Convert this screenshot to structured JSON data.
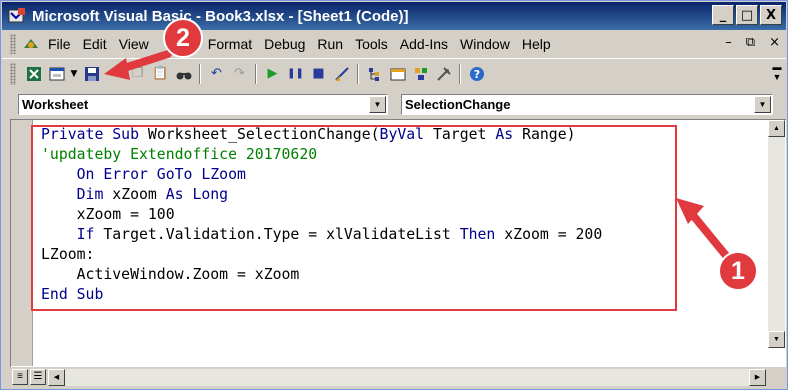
{
  "window": {
    "title": "Microsoft Visual Basic - Book3.xlsx - [Sheet1 (Code)]",
    "controls": {
      "minimize": "_",
      "restore": "□",
      "close": "X"
    }
  },
  "menubar": {
    "items": [
      "File",
      "Edit",
      "View",
      "Insert",
      "Format",
      "Debug",
      "Run",
      "Tools",
      "Add-Ins",
      "Window",
      "Help"
    ],
    "doc_controls": {
      "minimize": "–",
      "restore": "⧉",
      "close": "×"
    }
  },
  "toolbar": {
    "icons": [
      "view-excel-icon",
      "insert-userform-icon",
      "save-icon",
      "cut-icon",
      "copy-icon",
      "paste-icon",
      "find-icon",
      "undo-icon",
      "redo-icon",
      "run-icon",
      "break-icon",
      "reset-icon",
      "design-mode-icon",
      "project-explorer-icon",
      "properties-icon",
      "object-browser-icon",
      "toolbox-icon",
      "help-icon"
    ]
  },
  "object_dropdown": {
    "value": "Worksheet"
  },
  "procedure_dropdown": {
    "value": "SelectionChange"
  },
  "code": {
    "lines": [
      [
        {
          "t": "Private Sub ",
          "c": "kw"
        },
        {
          "t": "Worksheet_SelectionChange(",
          "c": ""
        },
        {
          "t": "ByVal ",
          "c": "kw"
        },
        {
          "t": "Target ",
          "c": ""
        },
        {
          "t": "As ",
          "c": "kw"
        },
        {
          "t": "Range)",
          "c": ""
        }
      ],
      [
        {
          "t": "'updateby Extendoffice 20170620",
          "c": "cm"
        }
      ],
      [
        {
          "t": "    On Error GoTo LZoom",
          "c": "kw"
        }
      ],
      [
        {
          "t": "    Dim ",
          "c": "kw"
        },
        {
          "t": "xZoom ",
          "c": ""
        },
        {
          "t": "As Long",
          "c": "kw"
        }
      ],
      [
        {
          "t": "    xZoom = 100",
          "c": ""
        }
      ],
      [
        {
          "t": "    If ",
          "c": "kw"
        },
        {
          "t": "Target.Validation.Type = xlValidateList ",
          "c": ""
        },
        {
          "t": "Then ",
          "c": "kw"
        },
        {
          "t": "xZoom = 200",
          "c": ""
        }
      ],
      [
        {
          "t": "LZoom:",
          "c": ""
        }
      ],
      [
        {
          "t": "    ActiveWindow.Zoom = xZoom",
          "c": ""
        }
      ],
      [
        {
          "t": "End Sub",
          "c": "kw"
        }
      ]
    ]
  },
  "annotations": {
    "badge_1": "1",
    "badge_2": "2",
    "color": "#e0393e"
  }
}
